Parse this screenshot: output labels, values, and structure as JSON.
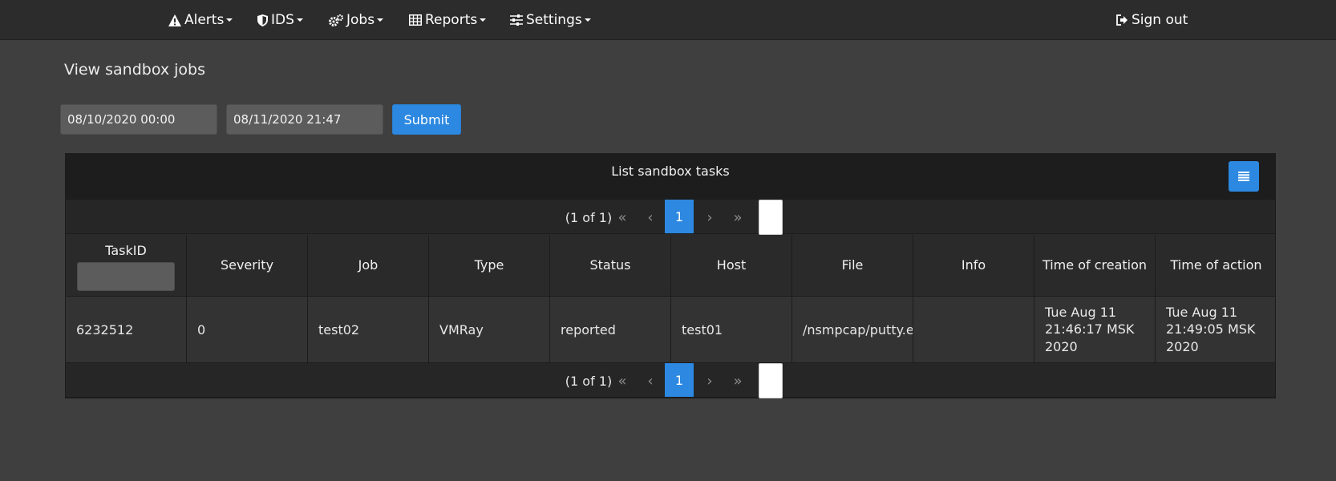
{
  "nav": {
    "alerts": "Alerts",
    "ids": "IDS",
    "jobs": "Jobs",
    "reports": "Reports",
    "settings": "Settings",
    "signout": "Sign out"
  },
  "page": {
    "title": "View sandbox jobs"
  },
  "filter": {
    "date_from": "08/10/2020 00:00",
    "date_to": "08/11/2020 21:47",
    "submit_label": "Submit"
  },
  "table": {
    "title": "List sandbox tasks",
    "paginator": {
      "report": "(1 of 1)",
      "first": "«",
      "prev": "‹",
      "page": "1",
      "next": "›",
      "last": "»"
    },
    "columns": [
      "TaskID",
      "Severity",
      "Job",
      "Type",
      "Status",
      "Host",
      "File",
      "Info",
      "Time of creation",
      "Time of action"
    ],
    "rows": [
      {
        "taskid": "6232512",
        "severity": "0",
        "job": "test02",
        "type": "VMRay",
        "status": "reported",
        "host": "test01",
        "file": "/nsmpcap/putty.exe",
        "info": "",
        "time_of_creation": "Tue Aug 11 21:46:17 MSK 2020",
        "time_of_action": "Tue Aug 11 21:49:05 MSK 2020"
      }
    ]
  },
  "colors": {
    "background": "#3f3f3f",
    "navbar": "#2c2c2c",
    "accent": "#2c88e0"
  }
}
